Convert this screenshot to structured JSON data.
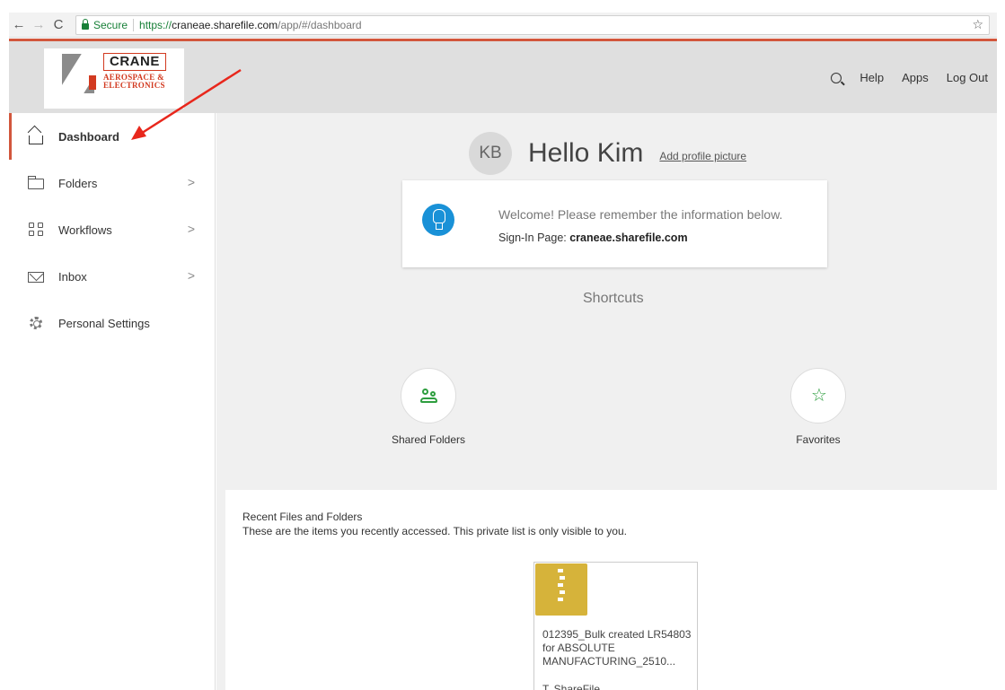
{
  "browser": {
    "back": "←",
    "forward": "→",
    "reload": "C",
    "secure_label": "Secure",
    "url_scheme": "https://",
    "url_host": "craneae.sharefile.com",
    "url_path": "/app/#/dashboard",
    "star": "☆"
  },
  "logo": {
    "name": "CRANE",
    "sub1": "AEROSPACE &",
    "sub2": "ELECTRONICS"
  },
  "topbar": {
    "help": "Help",
    "apps": "Apps",
    "logout": "Log Out"
  },
  "sidebar": {
    "items": [
      {
        "label": "Dashboard",
        "icon": "home-icon",
        "active": true
      },
      {
        "label": "Folders",
        "icon": "folder-icon",
        "chevron": true
      },
      {
        "label": "Workflows",
        "icon": "workflow-icon",
        "chevron": true
      },
      {
        "label": "Inbox",
        "icon": "mail-icon",
        "chevron": true
      },
      {
        "label": "Personal Settings",
        "icon": "gear-icon"
      }
    ]
  },
  "main": {
    "avatar_initials": "KB",
    "greeting": "Hello Kim",
    "add_picture": "Add profile picture",
    "welcome_text": "Welcome! Please remember the information below.",
    "signin_label": "Sign-In Page:",
    "signin_value": "craneae.sharefile.com",
    "shortcuts_title": "Shortcuts",
    "shortcuts": [
      {
        "label": "Shared Folders",
        "icon": "people-icon"
      },
      {
        "label": "Favorites",
        "icon": "star-icon"
      }
    ],
    "recent_title": "Recent Files and Folders",
    "recent_desc": "These are the items you recently accessed. This private list is only visible to you.",
    "recent_items": [
      {
        "name": "012395_Bulk created LR54803 for ABSOLUTE MANUFACTURING_2510...",
        "owner": "T. ShareFile",
        "icon": "zip-file-icon"
      }
    ]
  },
  "colors": {
    "accent": "#d2563c",
    "green": "#2e9e3f",
    "blue": "#1991d7",
    "zip": "#d6b33a",
    "annotation": "#e8271c"
  }
}
